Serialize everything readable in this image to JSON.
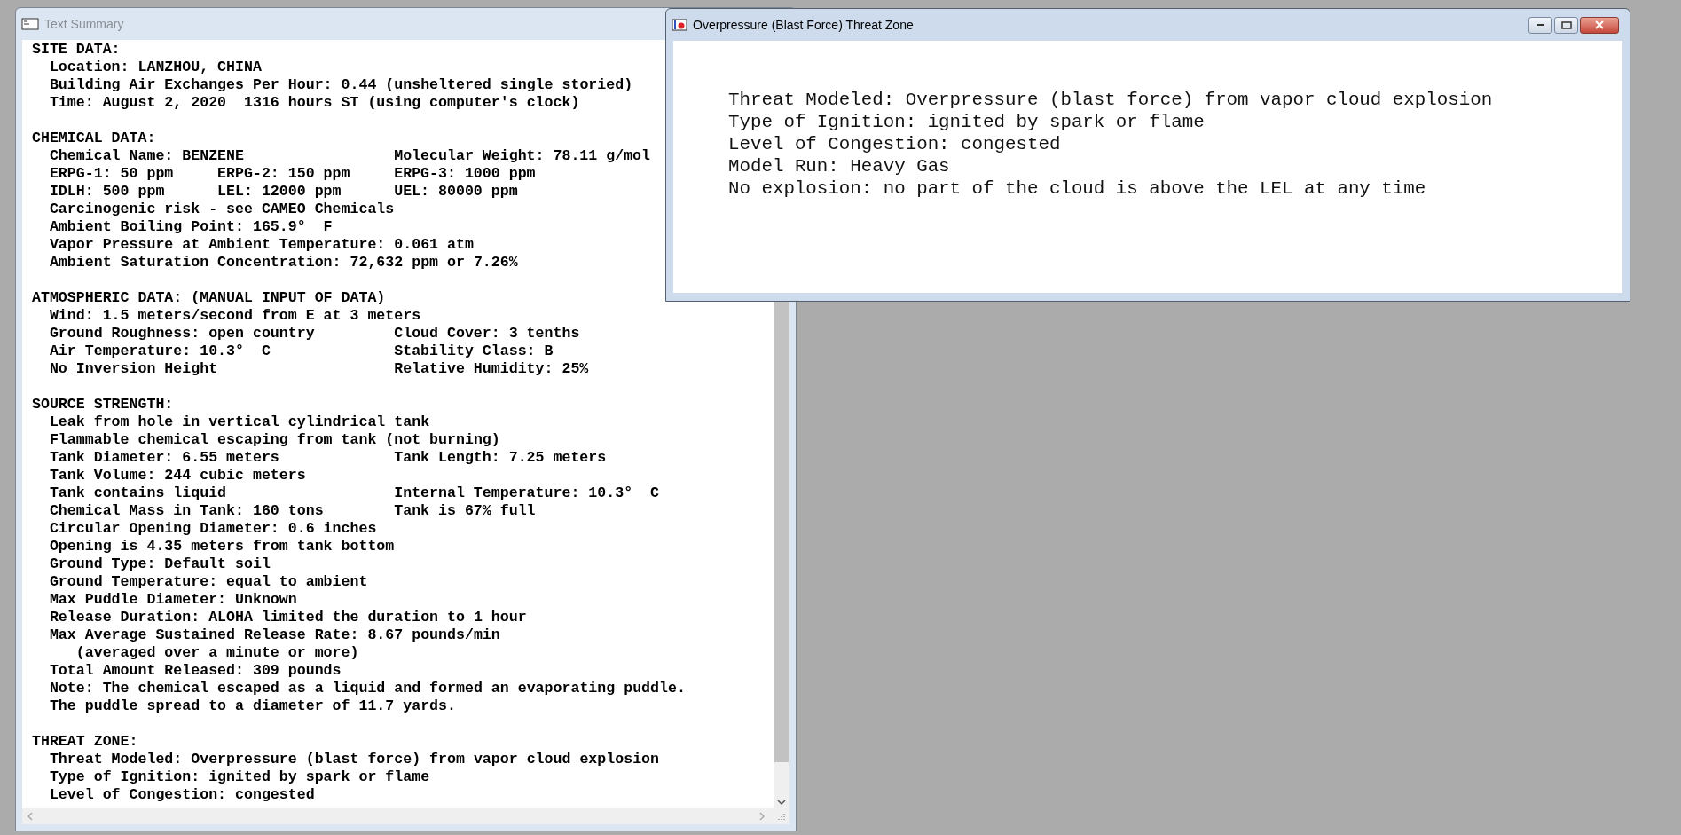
{
  "summary_window": {
    "title": "Text Summary",
    "active": false,
    "sections": [
      {
        "heading": "SITE DATA:",
        "lines": [
          {
            "cells": [
              "Location: LANZHOU, CHINA"
            ]
          },
          {
            "cells": [
              "Building Air Exchanges Per Hour: 0.44 (unsheltered single storied)"
            ]
          },
          {
            "cells": [
              "Time: August 2, 2020  1316 hours ST (using computer's clock)"
            ]
          }
        ]
      },
      {
        "heading": "CHEMICAL DATA:",
        "lines": [
          {
            "cells": [
              "Chemical Name: BENZENE",
              "Molecular Weight: 78.11 g/mol"
            ]
          },
          {
            "cells": [
              "ERPG-1: 50 ppm",
              "ERPG-2: 150 ppm",
              "ERPG-3: 1000 ppm"
            ]
          },
          {
            "cells": [
              "IDLH: 500 ppm",
              "LEL: 12000 ppm",
              "UEL: 80000 ppm"
            ]
          },
          {
            "cells": [
              "Carcinogenic risk - see CAMEO Chemicals"
            ]
          },
          {
            "cells": [
              "Ambient Boiling Point: 165.9°  F"
            ]
          },
          {
            "cells": [
              "Vapor Pressure at Ambient Temperature: 0.061 atm"
            ]
          },
          {
            "cells": [
              "Ambient Saturation Concentration: 72,632 ppm or 7.26%"
            ]
          }
        ]
      },
      {
        "heading": "ATMOSPHERIC DATA: (MANUAL INPUT OF DATA)",
        "lines": [
          {
            "cells": [
              "Wind: 1.5 meters/second from E at 3 meters"
            ]
          },
          {
            "cells": [
              "Ground Roughness: open country",
              "Cloud Cover: 3 tenths"
            ]
          },
          {
            "cells": [
              "Air Temperature: 10.3°  C",
              "Stability Class: B"
            ]
          },
          {
            "cells": [
              "No Inversion Height",
              "Relative Humidity: 25%"
            ]
          }
        ]
      },
      {
        "heading": "SOURCE STRENGTH:",
        "lines": [
          {
            "cells": [
              "Leak from hole in vertical cylindrical tank"
            ]
          },
          {
            "cells": [
              "Flammable chemical escaping from tank (not burning)"
            ]
          },
          {
            "cells": [
              "Tank Diameter: 6.55 meters",
              "Tank Length: 7.25 meters"
            ]
          },
          {
            "cells": [
              "Tank Volume: 244 cubic meters"
            ]
          },
          {
            "cells": [
              "Tank contains liquid",
              "Internal Temperature: 10.3°  C"
            ]
          },
          {
            "cells": [
              "Chemical Mass in Tank: 160 tons",
              "Tank is 67% full"
            ]
          },
          {
            "cells": [
              "Circular Opening Diameter: 0.6 inches"
            ]
          },
          {
            "cells": [
              "Opening is 4.35 meters from tank bottom"
            ]
          },
          {
            "cells": [
              "Ground Type: Default soil"
            ]
          },
          {
            "cells": [
              "Ground Temperature: equal to ambient"
            ]
          },
          {
            "cells": [
              "Max Puddle Diameter: Unknown"
            ]
          },
          {
            "cells": [
              "Release Duration: ALOHA limited the duration to 1 hour"
            ]
          },
          {
            "cells": [
              "Max Average Sustained Release Rate: 8.67 pounds/min"
            ]
          },
          {
            "kind": "continuation",
            "cells": [
              "(averaged over a minute or more)"
            ]
          },
          {
            "cells": [
              "Total Amount Released: 309 pounds"
            ]
          },
          {
            "cells": [
              "Note: The chemical escaped as a liquid and formed an evaporating puddle."
            ]
          },
          {
            "cells": [
              "The puddle spread to a diameter of 11.7 yards."
            ]
          }
        ]
      },
      {
        "heading": "THREAT ZONE:",
        "lines": [
          {
            "cells": [
              "Threat Modeled: Overpressure (blast force) from vapor cloud explosion"
            ]
          },
          {
            "cells": [
              "Type of Ignition: ignited by spark or flame"
            ]
          },
          {
            "cells": [
              "Level of Congestion: congested"
            ]
          }
        ]
      }
    ]
  },
  "threat_window": {
    "title": "Overpressure (Blast Force) Threat Zone",
    "active": true,
    "lines": [
      "Threat Modeled: Overpressure (blast force) from vapor cloud explosion",
      "Type of Ignition: ignited by spark or flame",
      "Level of Congestion: congested",
      "Model Run: Heavy Gas",
      "No explosion: no part of the cloud is above the LEL at any time"
    ]
  }
}
